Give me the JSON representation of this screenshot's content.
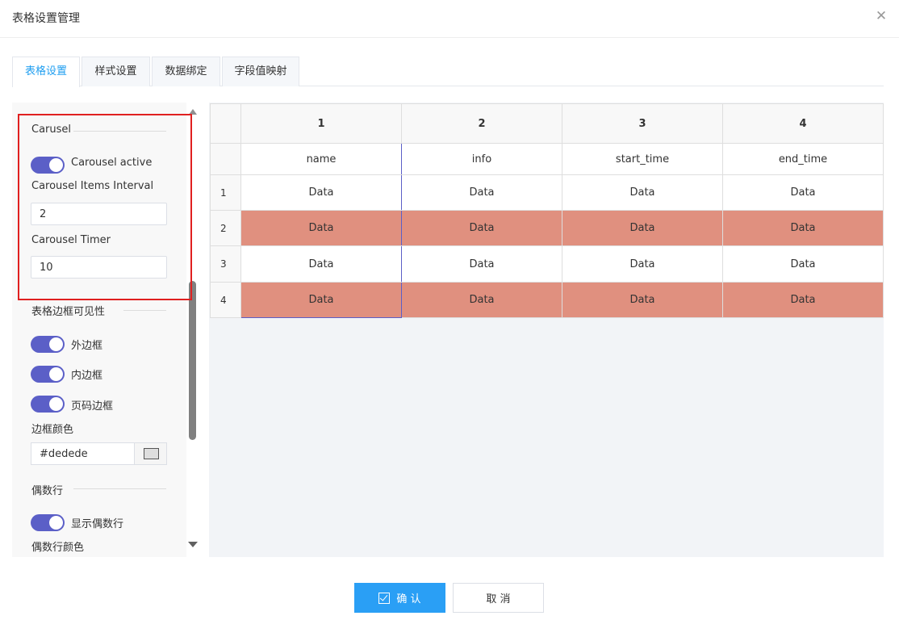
{
  "dialog": {
    "title": "表格设置管理",
    "close": "✕"
  },
  "tabs": [
    {
      "label": "表格设置",
      "active": true
    },
    {
      "label": "样式设置",
      "active": false
    },
    {
      "label": "数据绑定",
      "active": false
    },
    {
      "label": "字段值映射",
      "active": false
    }
  ],
  "panel": {
    "carousel": {
      "heading": "Carusel",
      "active_label": "Carousel active",
      "active_on": true,
      "interval_label": "Carousel Items Interval",
      "interval_value": "2",
      "timer_label": "Carousel Timer",
      "timer_value": "10"
    },
    "border": {
      "heading": "表格边框可见性",
      "outer_label": "外边框",
      "outer_on": true,
      "inner_label": "内边框",
      "inner_on": true,
      "pager_label": "页码边框",
      "pager_on": true,
      "color_label": "边框颜色",
      "color_value": "#dedede"
    },
    "even": {
      "heading": "偶数行",
      "show_label": "显示偶数行",
      "show_on": true,
      "color_label": "偶数行颜色"
    }
  },
  "table": {
    "columns": [
      "1",
      "2",
      "3",
      "4"
    ],
    "fields": [
      "name",
      "info",
      "start_time",
      "end_time"
    ],
    "rows": [
      {
        "num": "1",
        "cells": [
          "Data",
          "Data",
          "Data",
          "Data"
        ]
      },
      {
        "num": "2",
        "cells": [
          "Data",
          "Data",
          "Data",
          "Data"
        ]
      },
      {
        "num": "3",
        "cells": [
          "Data",
          "Data",
          "Data",
          "Data"
        ]
      },
      {
        "num": "4",
        "cells": [
          "Data",
          "Data",
          "Data",
          "Data"
        ]
      }
    ],
    "even_row_color": "#e0907f",
    "selection_color": "#5b5fc7"
  },
  "footer": {
    "confirm": "确 认",
    "cancel": "取 消"
  },
  "colors": {
    "accent": "#2a9ff5",
    "toggle": "#5b5fc7",
    "highlight": "#e02020"
  }
}
